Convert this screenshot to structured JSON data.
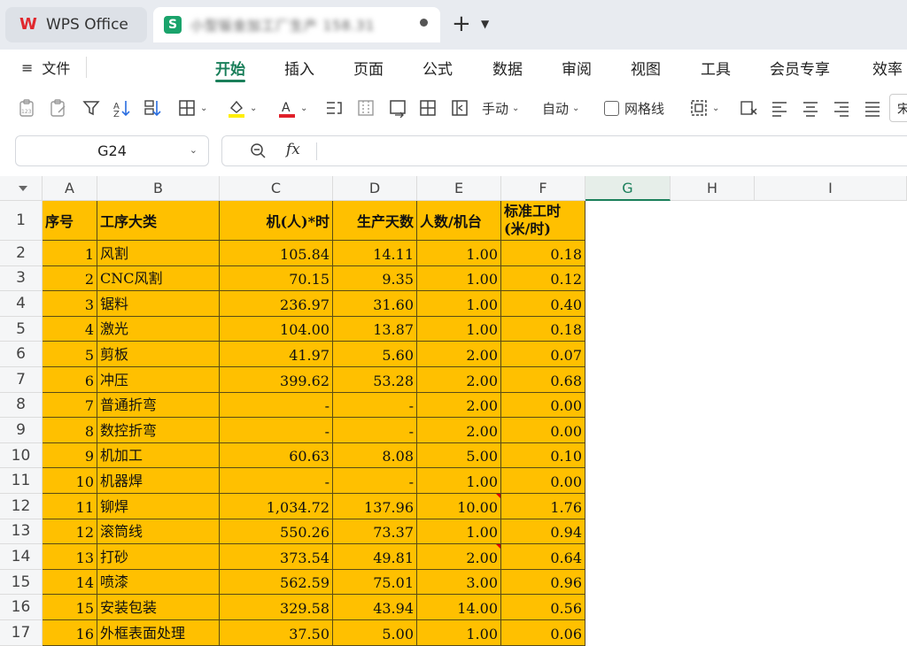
{
  "titlebar": {
    "app_name": "WPS Office",
    "doc_tab_title": "小型钣金加工厂生产 158.31",
    "new_tab_symbol": "+"
  },
  "menubar": {
    "file_label": "文件",
    "tabs": [
      "开始",
      "插入",
      "页面",
      "公式",
      "数据",
      "审阅",
      "视图",
      "工具",
      "会员专享",
      "效率"
    ],
    "active_tab": "开始"
  },
  "toolbar": {
    "row_height_label": "手动",
    "col_width_label": "自动",
    "gridlines_label": "网格线",
    "gridlines_checked": false,
    "font_box": "宋",
    "highlight_color": "#ffee00",
    "font_color": "#e0202a"
  },
  "formula_bar": {
    "cell_ref": "G24",
    "fx_label": "fx",
    "formula": ""
  },
  "sheet": {
    "columns": [
      "A",
      "B",
      "C",
      "D",
      "E",
      "F",
      "G",
      "H",
      "I"
    ],
    "selected_column": "G",
    "row_numbers": [
      "1",
      "2",
      "3",
      "4",
      "5",
      "6",
      "7",
      "8",
      "9",
      "10",
      "11",
      "12",
      "13",
      "14",
      "15",
      "16",
      "17"
    ],
    "header": [
      "序号",
      "工序大类",
      "机(人)*时",
      "生产天数",
      "人数/机台",
      "标准工时(米/时)"
    ],
    "rows": [
      [
        "1",
        "风割",
        "105.84",
        "14.11",
        "1.00",
        "0.18"
      ],
      [
        "2",
        "CNC风割",
        "70.15",
        "9.35",
        "1.00",
        "0.12"
      ],
      [
        "3",
        "锯料",
        "236.97",
        "31.60",
        "1.00",
        "0.40"
      ],
      [
        "4",
        "激光",
        "104.00",
        "13.87",
        "1.00",
        "0.18"
      ],
      [
        "5",
        "剪板",
        "41.97",
        "5.60",
        "2.00",
        "0.07"
      ],
      [
        "6",
        "冲压",
        "399.62",
        "53.28",
        "2.00",
        "0.68"
      ],
      [
        "7",
        "普通折弯",
        "-",
        "-",
        "2.00",
        "0.00"
      ],
      [
        "8",
        "数控折弯",
        "-",
        "-",
        "2.00",
        "0.00"
      ],
      [
        "9",
        "机加工",
        "60.63",
        "8.08",
        "5.00",
        "0.10"
      ],
      [
        "10",
        "机器焊",
        "-",
        "-",
        "1.00",
        "0.00"
      ],
      [
        "11",
        "铆焊",
        "1,034.72",
        "137.96",
        "10.00",
        "1.76"
      ],
      [
        "12",
        "滚筒线",
        "550.26",
        "73.37",
        "1.00",
        "0.94"
      ],
      [
        "13",
        "打砂",
        "373.54",
        "49.81",
        "2.00",
        "0.64"
      ],
      [
        "14",
        "喷漆",
        "562.59",
        "75.01",
        "3.00",
        "0.96"
      ],
      [
        "15",
        "安装包装",
        "329.58",
        "43.94",
        "14.00",
        "0.56"
      ],
      [
        "16",
        "外框表面处理",
        "37.50",
        "5.00",
        "1.00",
        "0.06"
      ]
    ],
    "fill_color": "#ffc000",
    "accent_color": "#1a7f5a"
  }
}
